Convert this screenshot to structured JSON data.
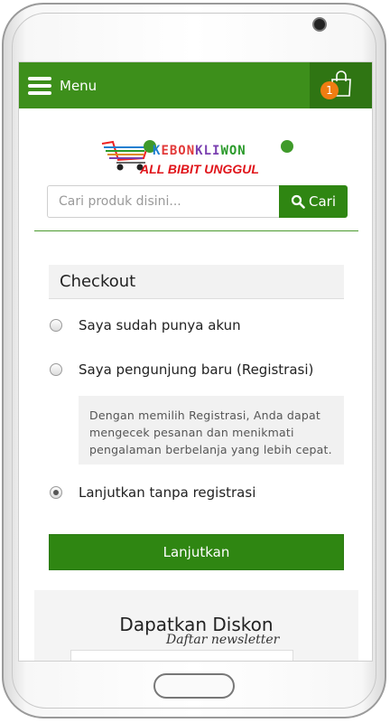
{
  "header": {
    "menu_label": "Menu",
    "cart_count": "1",
    "cart_icon": "shopping-bag-icon",
    "menu_icon": "hamburger-icon"
  },
  "brand": {
    "name_parts": [
      "K",
      "EBON",
      "KLI",
      "WON"
    ],
    "tagline": "ALL BIBIT UNGGUL"
  },
  "search": {
    "placeholder": "Cari produk disini...",
    "button_label": "Cari",
    "icon": "search-icon"
  },
  "checkout": {
    "title": "Checkout",
    "options": [
      {
        "label": "Saya sudah punya akun",
        "checked": false
      },
      {
        "label": "Saya pengunjung baru (Registrasi)",
        "checked": false
      },
      {
        "label": "Lanjutkan tanpa registrasi",
        "checked": true
      }
    ],
    "info": "Dengan memilih Registrasi, Anda dapat mengecek pesanan dan menikmati pengalaman berbelanja yang lebih cepat.",
    "continue_label": "Lanjutkan"
  },
  "newsletter": {
    "title": "Dapatkan Diskon",
    "subtitle": "Daftar newsletter"
  },
  "colors": {
    "primary": "#3d8f1b",
    "primary_dark": "#2f8612",
    "badge": "#ef7d12",
    "tagline": "#e0141a"
  }
}
